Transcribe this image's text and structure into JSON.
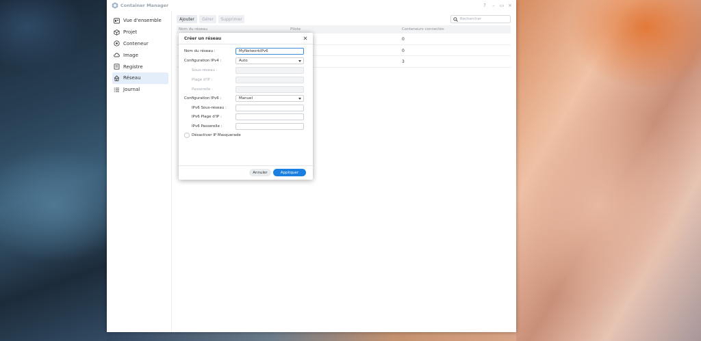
{
  "window": {
    "title": "Container Manager",
    "controls": {
      "help": "?",
      "minimize": "–",
      "maximize": "▭",
      "close": "×"
    }
  },
  "sidebar": {
    "items": [
      {
        "label": "Vue d'ensemble",
        "icon": "overview-icon",
        "active": false
      },
      {
        "label": "Projet",
        "icon": "project-icon",
        "active": false
      },
      {
        "label": "Conteneur",
        "icon": "container-icon",
        "active": false
      },
      {
        "label": "Image",
        "icon": "image-cloud-icon",
        "active": false
      },
      {
        "label": "Registre",
        "icon": "registry-icon",
        "active": false
      },
      {
        "label": "Réseau",
        "icon": "network-icon",
        "active": true
      },
      {
        "label": "Journal",
        "icon": "log-icon",
        "active": false
      }
    ]
  },
  "toolbar": {
    "add_label": "Ajouter",
    "manage_label": "Gérer",
    "delete_label": "Supprimer",
    "search_placeholder": "Rechercher"
  },
  "table": {
    "columns": [
      "Nom du réseau",
      "Pilote",
      "Conteneurs connectés"
    ],
    "rows": [
      {
        "connected": "0"
      },
      {
        "connected": "0"
      },
      {
        "connected": "3"
      }
    ]
  },
  "dialog": {
    "title": "Créer un réseau",
    "fields": {
      "network_name_label": "Nom du réseau :",
      "network_name_value": "MyNetworkIPv6",
      "ipv4_config_label": "Configuration IPv4 :",
      "ipv4_config_value": "Auto",
      "subnet_label": "Sous-réseau :",
      "ip_range_label": "Plage d'IP :",
      "gateway_label": "Passerelle :",
      "ipv6_config_label": "Configuration IPv6 :",
      "ipv6_config_value": "Manuel",
      "ipv6_subnet_label": "IPv6 Sous-réseau :",
      "ipv6_range_label": "IPv6 Plage d'IP :",
      "ipv6_gateway_label": "IPv6 Passerelle :",
      "masquerade_label": "Désactiver IP Masquerade"
    },
    "cancel_label": "Annuler",
    "apply_label": "Appliquer"
  },
  "colors": {
    "accent": "#1a7fe0",
    "sidebar_active_bg": "#e4eefa",
    "focus_border": "#3b8ddb"
  }
}
